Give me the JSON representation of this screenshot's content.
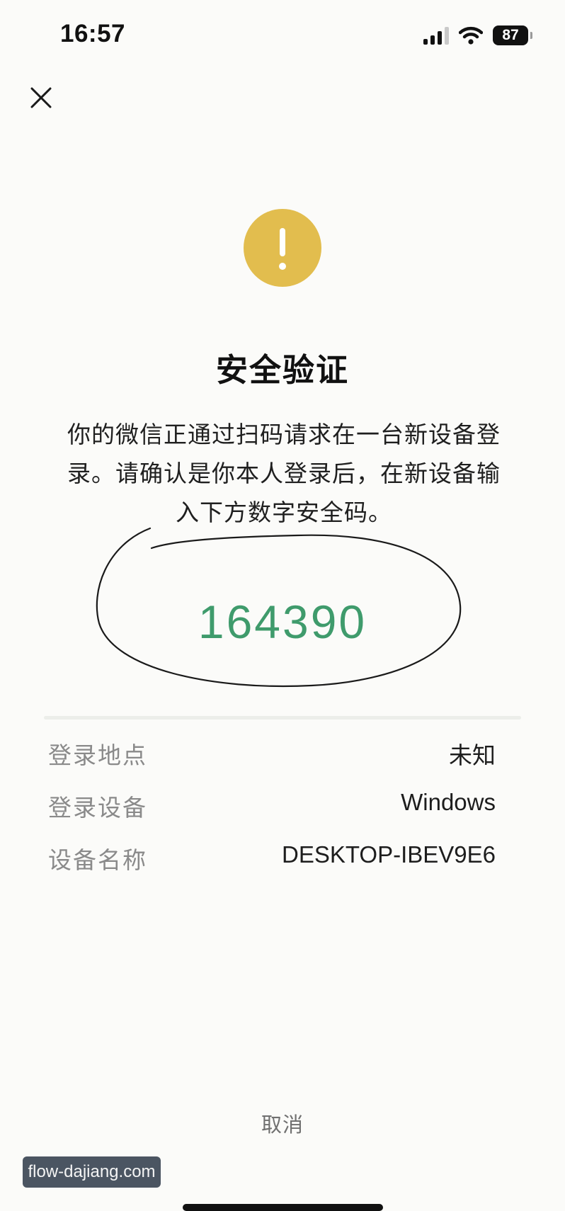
{
  "status_bar": {
    "time": "16:57",
    "battery_level": "87",
    "icons": [
      "signal-icon",
      "wifi-icon",
      "battery-icon"
    ]
  },
  "header": {
    "close_icon": "close-icon"
  },
  "warning": {
    "icon": "warning-icon",
    "color": "#e2bd4e"
  },
  "title": "安全验证",
  "description_lines": [
    "你的微信正通过扫码请求在一台新设备登",
    "录。请确认是你本人登录后，在新设备输",
    "入下方数字安全码。"
  ],
  "security_code": "164390",
  "security_code_color": "#3f9b6c",
  "details": [
    {
      "label": "登录地点",
      "value": "未知"
    },
    {
      "label": "登录设备",
      "value": "Windows"
    },
    {
      "label": "设备名称",
      "value": "DESKTOP-IBEV9E6"
    }
  ],
  "cancel_label": "取消",
  "watermark": "flow-dajiang.com"
}
